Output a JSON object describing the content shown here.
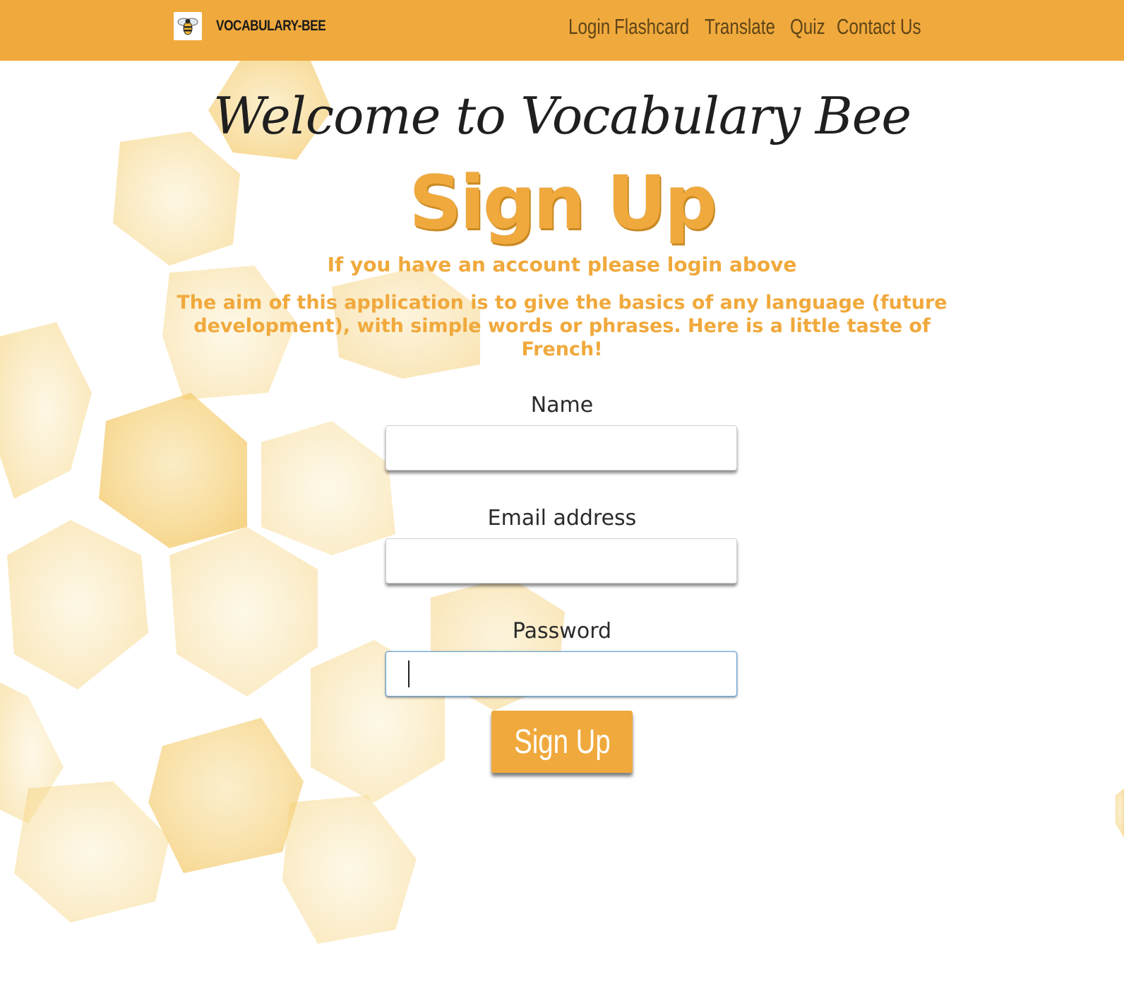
{
  "navbar": {
    "brand_name": "VOCABULARY-BEE",
    "links": [
      {
        "label": "Login"
      },
      {
        "label": "Flashcard"
      },
      {
        "label": "Translate"
      },
      {
        "label": "Quiz"
      },
      {
        "label": "Contact Us"
      }
    ]
  },
  "main": {
    "welcome": "Welcome to Vocabulary Bee",
    "title": "Sign Up",
    "subtitle": "If you have an account please login above",
    "aim": "The aim of this application is to give the basics of any language (future development), with simple words or phrases. Here is a little taste of French!"
  },
  "form": {
    "name_label": "Name",
    "name_value": "",
    "email_label": "Email address",
    "email_value": "",
    "password_label": "Password",
    "password_value": "",
    "submit_label": "Sign Up"
  },
  "icons": {
    "brand_logo": "bee-icon"
  },
  "colors": {
    "accent": "#f0a93c",
    "nav_link": "#5f4517",
    "background": "#ffffff",
    "hexagon": "#f5cf72"
  }
}
